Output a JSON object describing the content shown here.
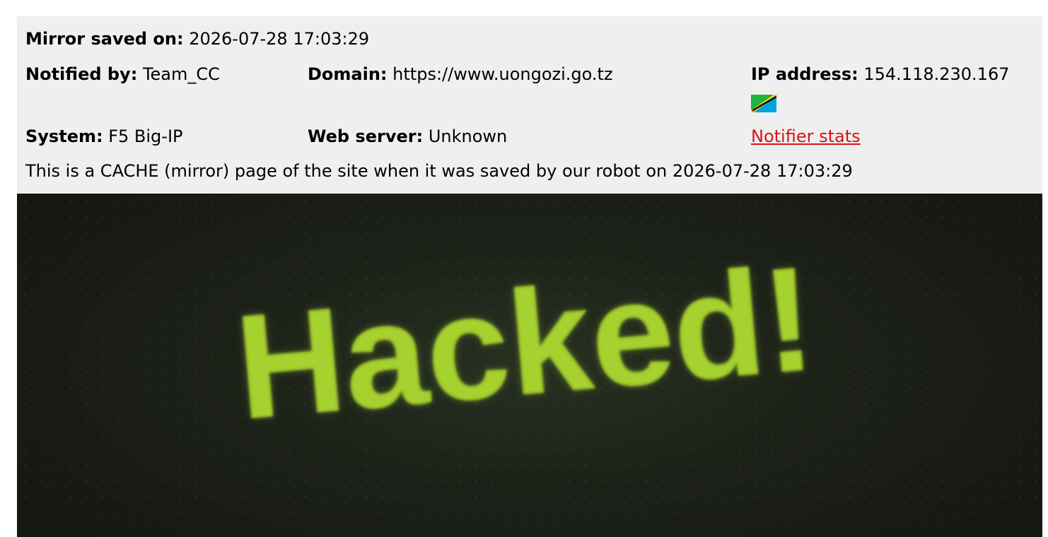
{
  "mirror": {
    "saved_label": "Mirror saved on:",
    "saved_value": "2026-07-28 17:03:29"
  },
  "notified": {
    "label": "Notified by:",
    "value": "Team_CC"
  },
  "domain": {
    "label": "Domain:",
    "value": "https://www.uongozi.go.tz"
  },
  "ip": {
    "label": "IP address:",
    "value": "154.118.230.167",
    "flag_icon": "tanzania-flag-icon"
  },
  "system": {
    "label": "System:",
    "value": "F5 Big-IP"
  },
  "web_server": {
    "label": "Web server:",
    "value": "Unknown"
  },
  "notifier_stats": {
    "label": "Notifier stats"
  },
  "cache_notice": "This is a CACHE (mirror) page of the site when it was saved by our robot on 2026-07-28 17:03:29",
  "mirror_page": {
    "headline": "Hacked!"
  },
  "colors": {
    "panel_bg": "#efefef",
    "link": "#dc1111",
    "headline": "#a6d12e",
    "mirror_bg": "#1d2219"
  }
}
